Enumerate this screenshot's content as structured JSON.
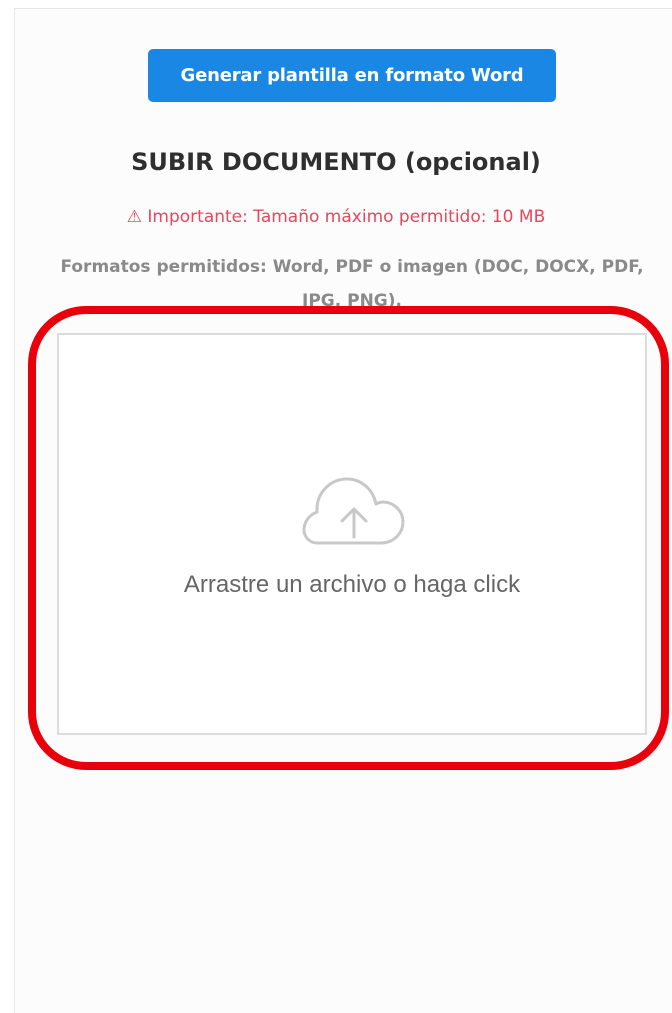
{
  "generate_button": {
    "label": "Generar plantilla en formato Word"
  },
  "upload": {
    "title": "SUBIR DOCUMENTO (opcional)",
    "warning": "⚠ Importante: Tamaño máximo permitido: 10 MB",
    "formats": "Formatos permitidos: Word, PDF o imagen (DOC, DOCX, PDF, JPG, PNG).",
    "dropzone_text": "Arrastre un archivo o haga click",
    "icon": "cloud-upload-icon"
  },
  "colors": {
    "button_blue": "#1a87e4",
    "warning_red": "#e8465b",
    "highlight_red": "#e8000a"
  }
}
